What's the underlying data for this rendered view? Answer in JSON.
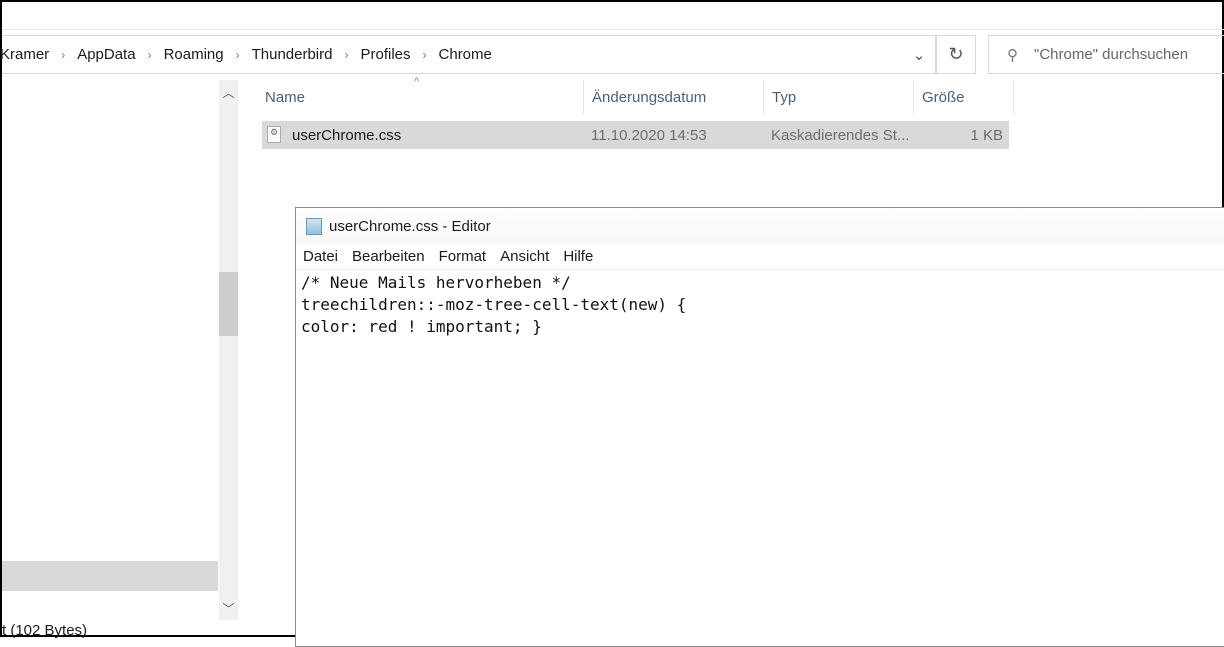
{
  "explorer": {
    "breadcrumb": [
      "Kramer",
      "AppData",
      "Roaming",
      "Thunderbird",
      "Profiles",
      "Chrome"
    ],
    "search_placeholder": "\"Chrome\" durchsuchen",
    "columns": [
      "Name",
      "Änderungsdatum",
      "Typ",
      "Größe"
    ],
    "files": [
      {
        "name": "userChrome.css",
        "date": "11.10.2020 14:53",
        "type": "Kaskadierendes St...",
        "size": "1 KB"
      }
    ],
    "status": "t (102 Bytes)"
  },
  "notepad": {
    "title": "userChrome.css - Editor",
    "menu": [
      "Datei",
      "Bearbeiten",
      "Format",
      "Ansicht",
      "Hilfe"
    ],
    "lines": [
      "/* Neue Mails hervorheben */",
      "treechildren::-moz-tree-cell-text(new) {",
      "color: red ! important; }"
    ]
  }
}
